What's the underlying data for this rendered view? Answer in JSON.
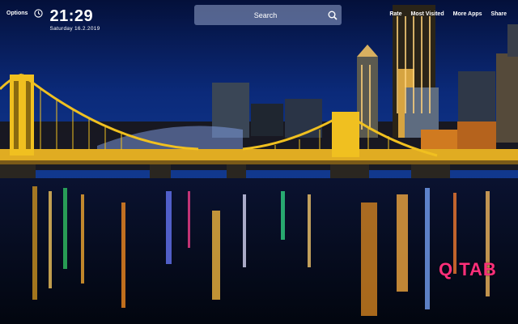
{
  "header": {
    "options_label": "Options",
    "time": "21:29",
    "date": "Saturday 16.2.2019"
  },
  "search": {
    "placeholder": "Search"
  },
  "nav": {
    "items": [
      "Rate",
      "Most Visited",
      "More Apps",
      "Share"
    ]
  },
  "brand": {
    "logo_text": "Q TAB"
  },
  "colors": {
    "brand": "#ff2f7a",
    "sky": "#0a1a4a",
    "bridge": "#f0c020",
    "water": "#050b20"
  },
  "icons": {
    "clock": "clock-icon",
    "search": "search-icon"
  }
}
